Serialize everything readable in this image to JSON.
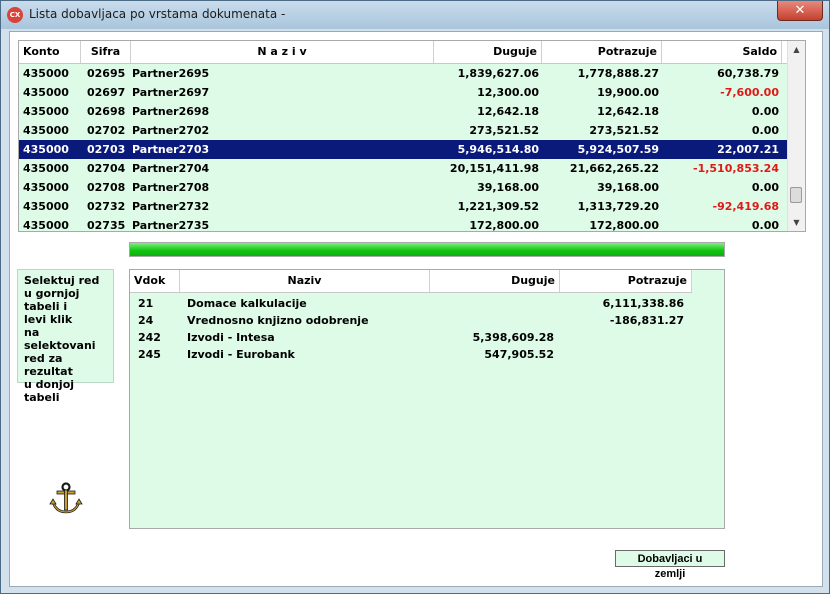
{
  "window": {
    "title": "Lista dobavljaca po vrstama dokumenata -",
    "app_icon_text": "CX",
    "close_symbol": "✕"
  },
  "top_table": {
    "columns": [
      "Konto",
      "Sifra",
      "N a z i v",
      "Duguje",
      "Potrazuje",
      "Saldo"
    ],
    "rows": [
      {
        "konto": "435000",
        "sifra": "02695",
        "naziv": "Partner2695",
        "duguje": "1,839,627.06",
        "potrazuje": "1,778,888.27",
        "saldo": "60,738.79",
        "negative": false,
        "selected": false
      },
      {
        "konto": "435000",
        "sifra": "02697",
        "naziv": "Partner2697",
        "duguje": "12,300.00",
        "potrazuje": "19,900.00",
        "saldo": "-7,600.00",
        "negative": true,
        "selected": false
      },
      {
        "konto": "435000",
        "sifra": "02698",
        "naziv": "Partner2698",
        "duguje": "12,642.18",
        "potrazuje": "12,642.18",
        "saldo": "0.00",
        "negative": false,
        "selected": false
      },
      {
        "konto": "435000",
        "sifra": "02702",
        "naziv": "Partner2702",
        "duguje": "273,521.52",
        "potrazuje": "273,521.52",
        "saldo": "0.00",
        "negative": false,
        "selected": false
      },
      {
        "konto": "435000",
        "sifra": "02703",
        "naziv": "Partner2703",
        "duguje": "5,946,514.80",
        "potrazuje": "5,924,507.59",
        "saldo": "22,007.21",
        "negative": false,
        "selected": true
      },
      {
        "konto": "435000",
        "sifra": "02704",
        "naziv": "Partner2704",
        "duguje": "20,151,411.98",
        "potrazuje": "21,662,265.22",
        "saldo": "-1,510,853.24",
        "negative": true,
        "selected": false
      },
      {
        "konto": "435000",
        "sifra": "02708",
        "naziv": "Partner2708",
        "duguje": "39,168.00",
        "potrazuje": "39,168.00",
        "saldo": "0.00",
        "negative": false,
        "selected": false
      },
      {
        "konto": "435000",
        "sifra": "02732",
        "naziv": "Partner2732",
        "duguje": "1,221,309.52",
        "potrazuje": "1,313,729.20",
        "saldo": "-92,419.68",
        "negative": true,
        "selected": false
      },
      {
        "konto": "435000",
        "sifra": "02735",
        "naziv": "Partner2735",
        "duguje": "172,800.00",
        "potrazuje": "172,800.00",
        "saldo": "0.00",
        "negative": false,
        "selected": false
      }
    ]
  },
  "progress": {
    "value": 1.0,
    "color": "#14c614"
  },
  "note": {
    "text": "Selektuj red\nu gornjoj\ntabeli i\nlevi klik\nna selektovani\nred za rezultat\nu donjoj tabeli"
  },
  "bottom_table": {
    "columns": [
      "Vdok",
      "Naziv",
      "Duguje",
      "Potrazuje"
    ],
    "rows": [
      {
        "vdok": "21",
        "naziv": "Domace kalkulacije",
        "duguje": "",
        "potrazuje": "6,111,338.86"
      },
      {
        "vdok": "24",
        "naziv": "Vrednosno knjizno odobrenje",
        "duguje": "",
        "potrazuje": "-186,831.27"
      },
      {
        "vdok": "242",
        "naziv": "Izvodi - Intesa",
        "duguje": "5,398,609.28",
        "potrazuje": ""
      },
      {
        "vdok": "245",
        "naziv": "Izvodi - Eurobank",
        "duguje": "547,905.52",
        "potrazuje": ""
      }
    ]
  },
  "buttons": {
    "domestic_suppliers": "Dobavljaci u zemlji"
  },
  "icons": {
    "logo": "anchor-icon",
    "scroll_up": "arrow-up-icon",
    "scroll_down": "arrow-down-icon"
  },
  "colors": {
    "grid_bg": "#ddfbe7",
    "selection": "#0a1a7a",
    "negative": "#e01818"
  }
}
